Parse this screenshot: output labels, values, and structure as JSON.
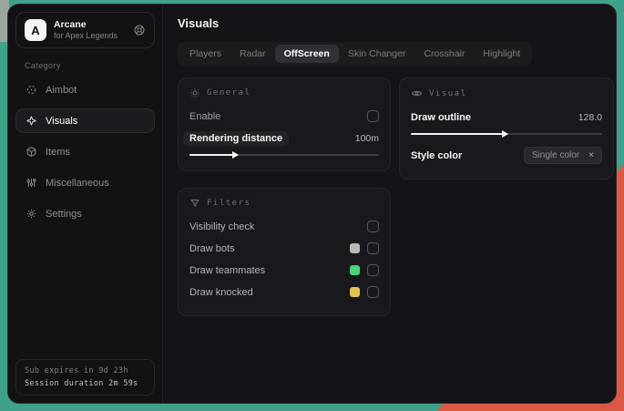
{
  "colors": {
    "desktop_teal": "#3FA189",
    "desktop_red": "#DB5844",
    "swatch_bots": "#b8b8b6",
    "swatch_teammates": "#46d673",
    "swatch_knocked": "#e2c250"
  },
  "sidebar": {
    "app": {
      "logo_letter": "A",
      "name": "Arcane",
      "subtitle": "for Apex Legends"
    },
    "category_label": "Category",
    "items": [
      {
        "label": "Aimbot",
        "icon": "crosshair-icon"
      },
      {
        "label": "Visuals",
        "icon": "sparkle-icon"
      },
      {
        "label": "Items",
        "icon": "cube-icon"
      },
      {
        "label": "Miscellaneous",
        "icon": "sliders-icon"
      },
      {
        "label": "Settings",
        "icon": "gear-icon"
      }
    ],
    "footer": {
      "line1": "Sub expires in 9d 23h",
      "line2": "Session duration 2m 59s"
    }
  },
  "main": {
    "title": "Visuals",
    "tabs": [
      {
        "label": "Players"
      },
      {
        "label": "Radar"
      },
      {
        "label": "OffScreen"
      },
      {
        "label": "Skin Changer"
      },
      {
        "label": "Crosshair"
      },
      {
        "label": "Highlight"
      }
    ],
    "panels": {
      "general": {
        "title": "General",
        "enable_label": "Enable",
        "distance_label": "Rendering distance",
        "distance_value": "100m",
        "distance_fill": "25%"
      },
      "filters": {
        "title": "Filters",
        "rows": [
          {
            "label": "Visibility check"
          },
          {
            "label": "Draw bots"
          },
          {
            "label": "Draw teammates"
          },
          {
            "label": "Draw knocked"
          }
        ]
      },
      "visual": {
        "title": "Visual",
        "outline_label": "Draw outline",
        "outline_value": "128.0",
        "outline_fill": "50%",
        "style_label": "Style color",
        "tag_label": "Single color",
        "tag_close": "×"
      }
    }
  }
}
